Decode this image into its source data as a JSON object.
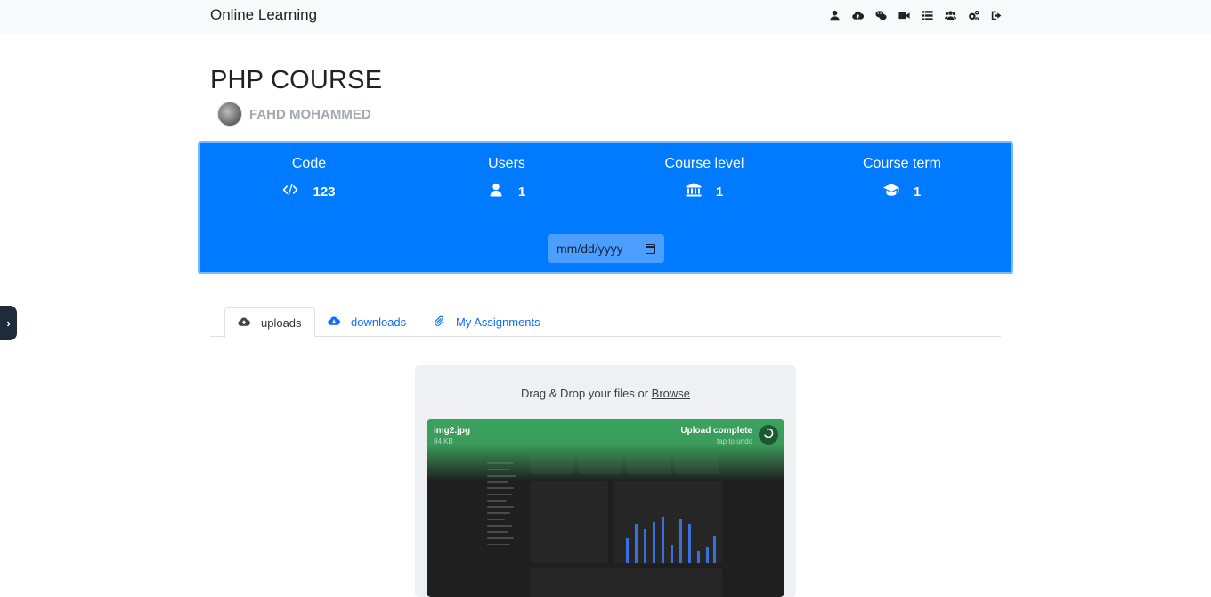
{
  "navbar": {
    "brand": "Online Learning",
    "icons": [
      "user-icon",
      "cloud-icon",
      "chat-icon",
      "video-icon",
      "list-icon",
      "users-icon",
      "settings-icon",
      "logout-icon"
    ]
  },
  "course": {
    "title": "PHP COURSE",
    "author": "FAHD MOHAMMED"
  },
  "info_card": {
    "accent_color": "#007bff",
    "stats": [
      {
        "label": "Code",
        "value": "123",
        "icon": "code-icon"
      },
      {
        "label": "Users",
        "value": "1",
        "icon": "user-icon"
      },
      {
        "label": "Course level",
        "value": "1",
        "icon": "institution-icon"
      },
      {
        "label": "Course term",
        "value": "1",
        "icon": "graduation-cap-icon"
      }
    ],
    "date_placeholder": "mm/dd/yyyy"
  },
  "tabs": [
    {
      "label": "uploads",
      "icon": "cloud-upload-icon",
      "active": true
    },
    {
      "label": "downloads",
      "icon": "cloud-download-icon",
      "active": false
    },
    {
      "label": "My Assignments",
      "icon": "paperclip-icon",
      "active": false
    }
  ],
  "uploader": {
    "drop_text": "Drag & Drop your files or ",
    "browse_label": "Browse",
    "file": {
      "name": "img2.jpg",
      "size": "84 KB",
      "status": "Upload complete",
      "undo_hint": "tap to undo"
    }
  }
}
